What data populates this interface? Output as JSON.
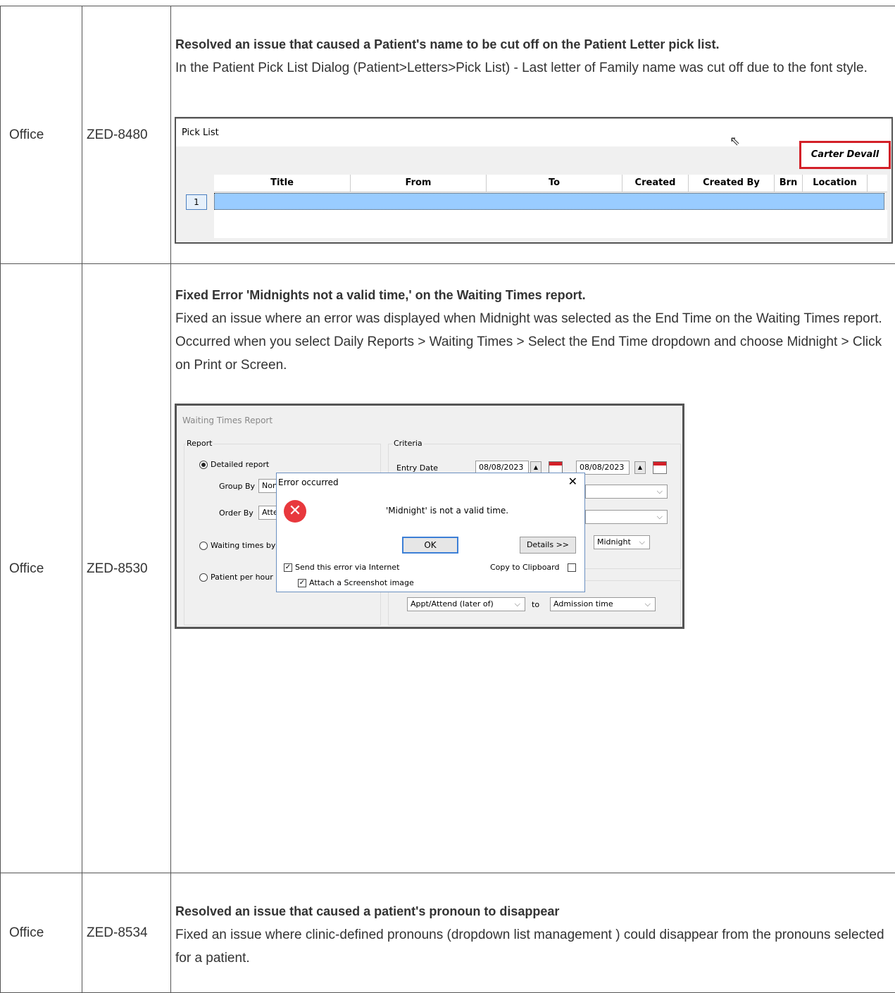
{
  "rows": [
    {
      "product": "Office",
      "ticket": "ZED-8480",
      "title": "Resolved an issue that caused a Patient's name to be cut off on the Patient Letter pick list.",
      "description": "In the Patient Pick List Dialog (Patient>Letters>Pick List) - Last letter of Family name was cut off due to the font style."
    },
    {
      "product": "Office",
      "ticket": "ZED-8530",
      "title": "Fixed Error 'Midnights not a valid time,' on the Waiting Times report.",
      "description": "Fixed an issue where an error was displayed when Midnight was selected as the End Time on the Waiting Times report. Occurred when you select Daily Reports > Waiting Times > Select the End Time dropdown and choose Midnight > Click on Print or Screen."
    },
    {
      "product": "Office",
      "ticket": "ZED-8534",
      "title": "Resolved an issue that caused a patient's pronoun to disappear",
      "description": "Fixed an issue where clinic-defined pronouns (dropdown list management ) could disappear from the pronouns selected for a patient."
    }
  ],
  "picklist": {
    "window_title": "Pick  List",
    "patient_name": "Carter Devall",
    "columns": [
      "Title",
      "From",
      "To",
      "Created",
      "Created By",
      "Brn",
      "Location"
    ],
    "row_number": "1"
  },
  "waiting_report": {
    "window_title": "Waiting Times Report",
    "report_group": "Report",
    "criteria_group": "Criteria",
    "detailed_report": "Detailed report",
    "group_by_label": "Group By",
    "group_by_value": "Non",
    "order_by_label": "Order By",
    "order_by_value": "Atte",
    "waiting_by_hour": "Waiting times by h",
    "patient_per_hour": "Patient per hour b",
    "entry_date_label": "Entry Date",
    "date_from": "08/08/2023",
    "date_to": "08/08/2023",
    "end_time_value": "Midnight",
    "from_field": "Appt/Attend (later of)",
    "to_label": "to",
    "to_field": "Admission time",
    "dialog": {
      "title": "Error occurred",
      "message": "'Midnight' is not a valid time.",
      "ok": "OK",
      "details": "Details >>",
      "send_error": "Send this error via Internet",
      "attach_screenshot": "Attach a Screenshot image",
      "copy_clipboard": "Copy to Clipboard"
    }
  }
}
